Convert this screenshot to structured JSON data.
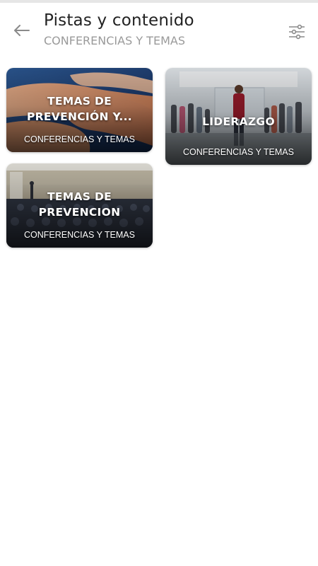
{
  "header": {
    "title": "Pistas y contenido",
    "subtitle": "CONFERENCIAS Y TEMAS",
    "back_icon": "arrow-left-icon",
    "filter_icon": "sliders-icon"
  },
  "cards": [
    {
      "title": "TEMAS DE PREVENCIÓN Y...",
      "category": "CONFERENCIAS Y TEMAS",
      "image": "hands-holding-photo"
    },
    {
      "title": "LIDERAZGO",
      "category": "CONFERENCIAS Y TEMAS",
      "image": "team-leader-photo"
    },
    {
      "title": "TEMAS DE PREVENCION",
      "category": "CONFERENCIAS Y TEMAS",
      "image": "auditorium-audience-photo"
    }
  ],
  "colors": {
    "background": "#ffffff",
    "title": "#222222",
    "subtitle": "#9a9a9a",
    "icon": "#8a8a8a"
  }
}
